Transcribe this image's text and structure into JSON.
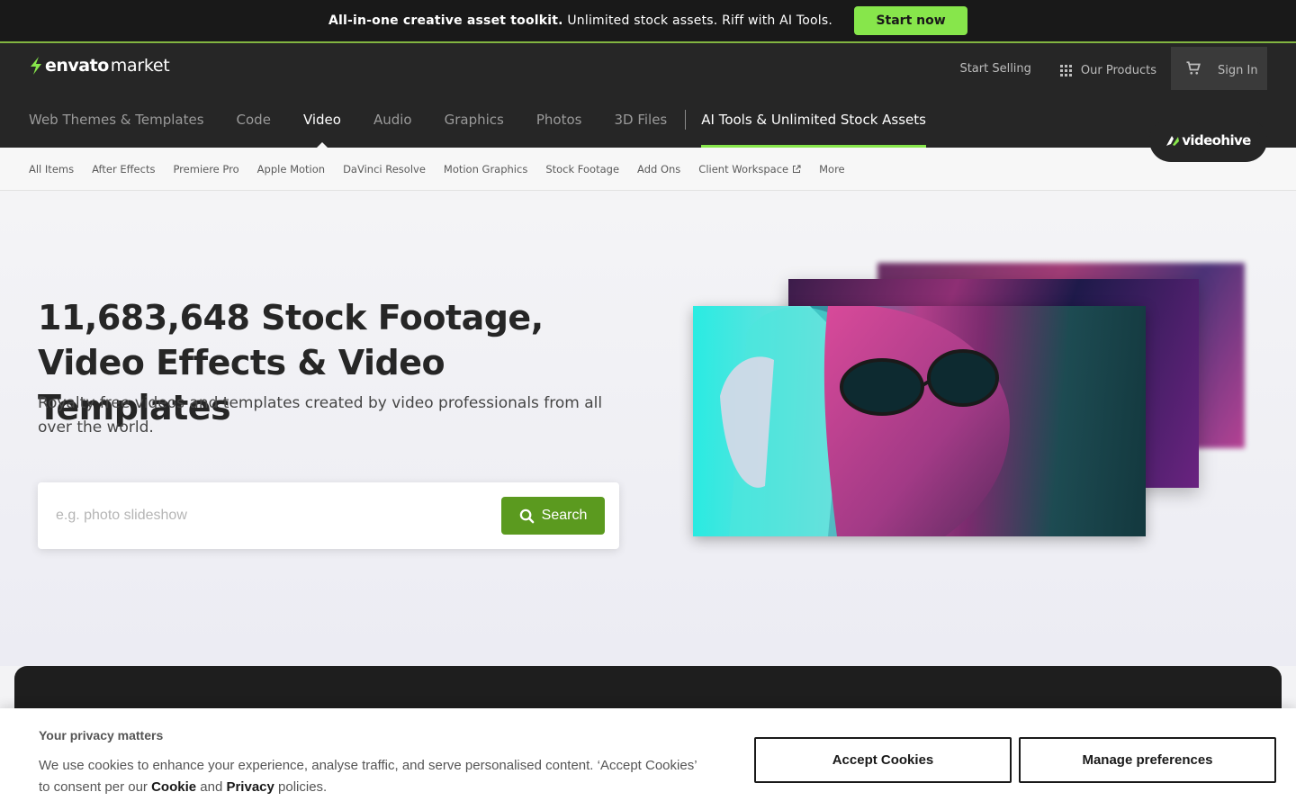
{
  "promo": {
    "bold": "All-in-one creative asset toolkit.",
    "text": " Unlimited stock assets. Riff with AI Tools.",
    "cta": "Start now"
  },
  "header": {
    "logo_envato": "envato",
    "logo_market": "market",
    "start_selling": "Start Selling",
    "our_products": "Our Products",
    "sign_in": "Sign In",
    "nav": [
      "Web Themes & Templates",
      "Code",
      "Video",
      "Audio",
      "Graphics",
      "Photos",
      "3D Files"
    ],
    "active_nav": "Video",
    "ai_link": "AI Tools & Unlimited Stock Assets",
    "badge": "videohive"
  },
  "subnav": [
    "All Items",
    "After Effects",
    "Premiere Pro",
    "Apple Motion",
    "DaVinci Resolve",
    "Motion Graphics",
    "Stock Footage",
    "Add Ons",
    "Client Workspace",
    "More"
  ],
  "hero": {
    "title": "11,683,648 Stock Footage, Video Effects & Video Templates",
    "subtitle": "Royalty free videos and templates created by video professionals from all over the world.",
    "search_placeholder": "e.g. photo slideshow",
    "search_button": "Search"
  },
  "cookie": {
    "title": "Your privacy matters",
    "text_1": "We use cookies to enhance your experience, analyse traffic, and serve personalised content. ‘Accept Cookies’ to consent per our ",
    "cookie_link": "Cookie",
    "and": " and ",
    "privacy_link": "Privacy",
    "text_2": " policies.",
    "accept": "Accept Cookies",
    "manage": "Manage preferences"
  },
  "colors": {
    "accent_green": "#87e64b",
    "search_green": "#5b9a1f",
    "header_bg": "#262626"
  }
}
